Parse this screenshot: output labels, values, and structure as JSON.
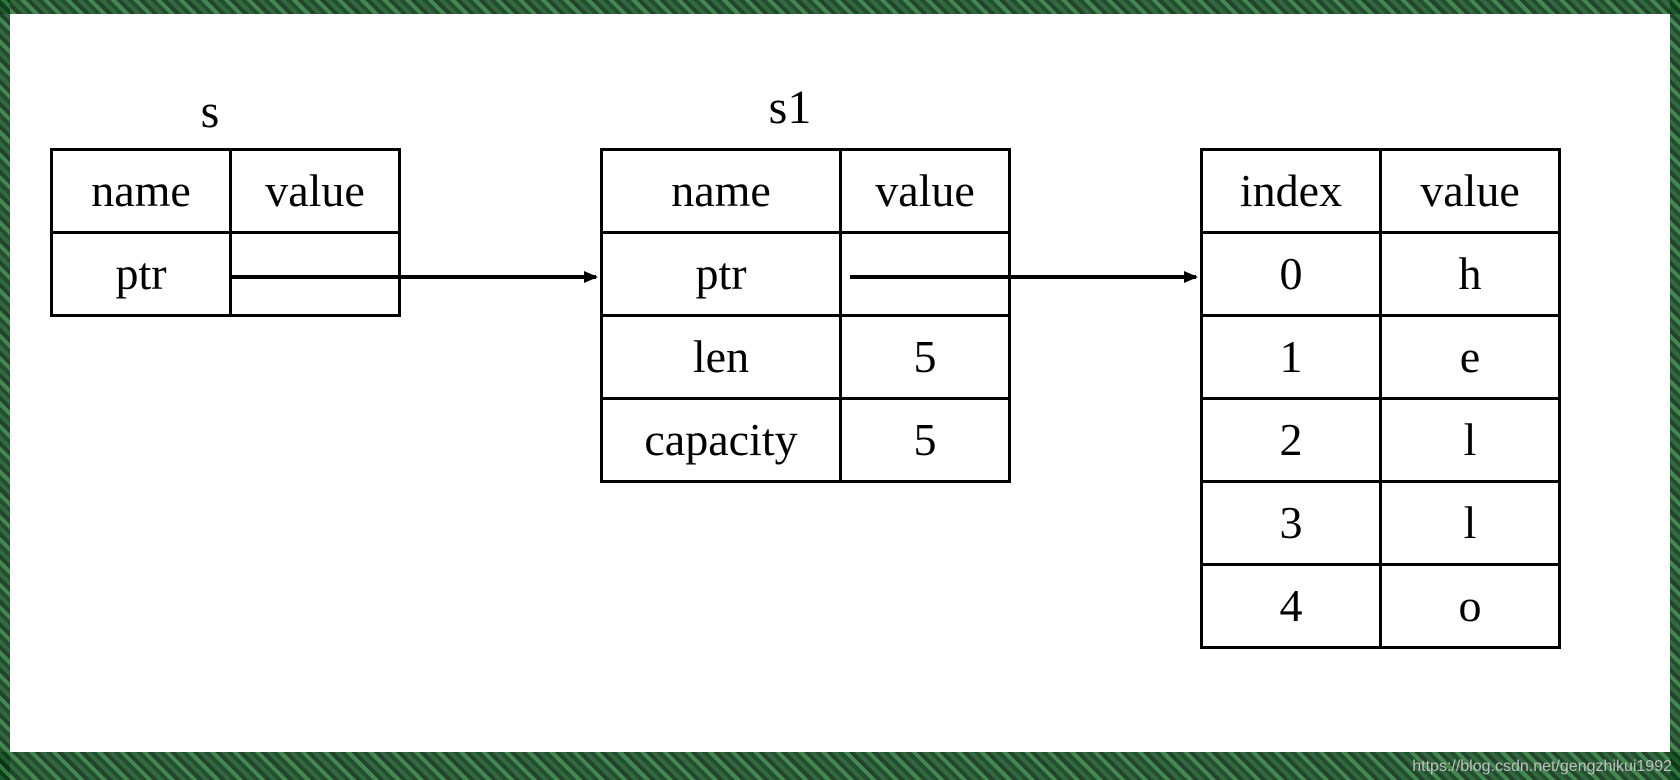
{
  "titles": {
    "s": "s",
    "s1": "s1"
  },
  "tables": {
    "s": {
      "header": [
        "name",
        "value"
      ],
      "rows": [
        {
          "name": "ptr",
          "value": ""
        }
      ]
    },
    "s1": {
      "header": [
        "name",
        "value"
      ],
      "rows": [
        {
          "name": "ptr",
          "value": ""
        },
        {
          "name": "len",
          "value": "5"
        },
        {
          "name": "capacity",
          "value": "5"
        }
      ]
    },
    "heap": {
      "header": [
        "index",
        "value"
      ],
      "rows": [
        {
          "index": "0",
          "value": "h"
        },
        {
          "index": "1",
          "value": "e"
        },
        {
          "index": "2",
          "value": "l"
        },
        {
          "index": "3",
          "value": "l"
        },
        {
          "index": "4",
          "value": "o"
        }
      ]
    }
  },
  "watermark": "https://blog.csdn.net/gengzhikui1992"
}
